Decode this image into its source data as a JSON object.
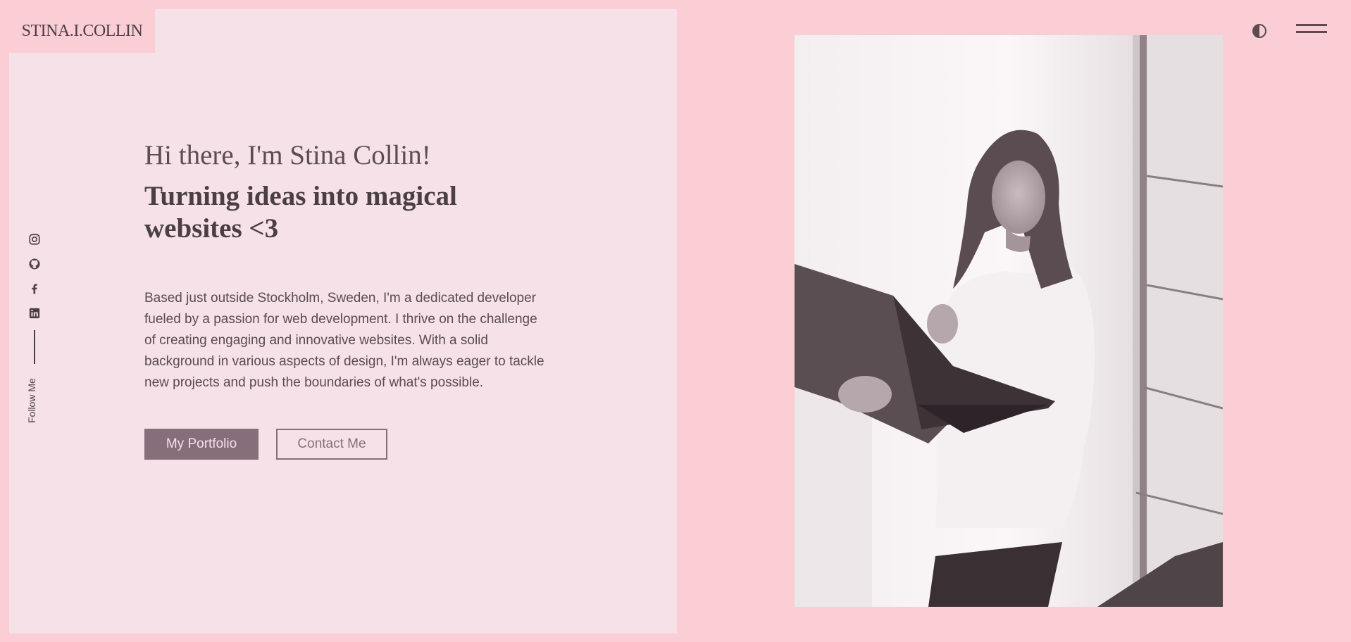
{
  "site": {
    "logo": "STINA.I.COLLIN"
  },
  "header": {
    "theme_toggle_icon": "contrast-icon",
    "menu_icon": "hamburger-menu-icon"
  },
  "social": {
    "follow_label": "Follow Me",
    "icons": [
      "instagram-icon",
      "github-icon",
      "facebook-icon",
      "linkedin-icon"
    ]
  },
  "hero": {
    "greeting": "Hi there, I'm Stina Collin!",
    "headline": "Turning ideas into magical websites <3",
    "bio": "Based just outside Stockholm, Sweden, I'm a dedicated developer fueled by a passion for web development. I thrive on the challenge of creating engaging and innovative websites. With a solid background in various aspects of design, I'm always eager to tackle new projects and push the boundaries of what's possible.",
    "primary_button": "My Portfolio",
    "secondary_button": "Contact Me"
  },
  "colors": {
    "background": "#fbcdd5",
    "panel": "#f5e1e7",
    "text": "#4a3f43",
    "accent": "#866f7b"
  }
}
